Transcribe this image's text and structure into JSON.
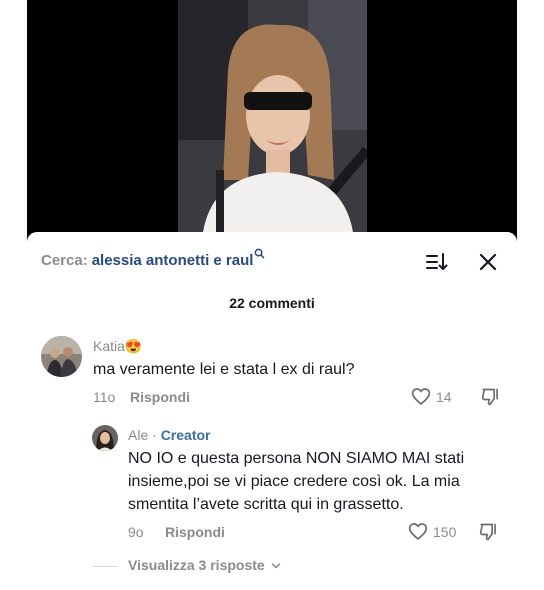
{
  "search": {
    "prefix": "Cerca:",
    "term": "alessia antonetti e raul",
    "icon": "search-icon"
  },
  "header": {
    "sort_icon": "sort-icon",
    "close_icon": "close-icon"
  },
  "comments_count": "22 commenti",
  "comments": [
    {
      "username": "Katia",
      "emoji": "😍",
      "text": "ma veramente lei e stata l ex di raul?",
      "time": "11o",
      "reply_label": "Rispondi",
      "likes": "14"
    }
  ],
  "reply": {
    "username": "Ale",
    "separator": "·",
    "badge": "Creator",
    "text": "NO IO e questa persona NON SIAMO MAI stati insieme,poi se vi piace credere così ok. La mia smentita l’avete scritta qui in grassetto.",
    "time": "9o",
    "reply_label": "Rispondi",
    "likes": "150"
  },
  "view_replies": {
    "label": "Visualizza 3 risposte",
    "icon": "chevron-down-icon"
  },
  "colors": {
    "search_term": "#2a4a7f",
    "creator_badge": "#3a6ea5",
    "muted": "#8a8b91",
    "text": "#161823"
  }
}
